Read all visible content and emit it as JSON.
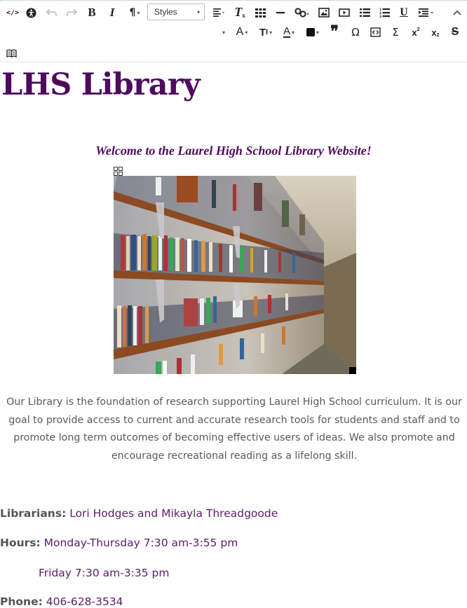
{
  "toolbar": {
    "row1": [
      {
        "name": "source-code-button",
        "glyph": "</>"
      },
      {
        "name": "accessibility-button",
        "glyph": "accessibility"
      },
      {
        "name": "undo-button",
        "glyph": "↶",
        "disabled": true
      },
      {
        "name": "redo-button",
        "glyph": "↷",
        "disabled": true
      },
      {
        "name": "bold-button",
        "glyph": "B"
      },
      {
        "name": "italic-button",
        "glyph": "I"
      },
      {
        "name": "paragraph-format-button",
        "glyph": "¶"
      }
    ],
    "styles_select": "Styles",
    "collapse_icon": "chevron-up-icon"
  },
  "page": {
    "title": "LHS Library",
    "welcome": "Welcome to the Laurel High School Library Website!",
    "intro": "Our Library is the foundation of research supporting Laurel High School curriculum.  It is our goal to provide access to current and accurate research tools for students and staff and to promote long term outcomes of becoming effective users of ideas.  We also promote and encourage recreational reading as a lifelong skill.",
    "librarians_label": "Librarians:",
    "librarians_value": "Lori Hodges and Mikayla Threadgoode",
    "hours_label": "Hours:",
    "hours_value": "Monday-Thursday 7:30 am-3:55 pm",
    "hours_friday": "Friday 7:30 am-3:35 pm",
    "phone_label": "Phone:",
    "phone_value": "406-628-3534"
  },
  "colors": {
    "heading": "#4e0b5e",
    "link_value": "#5d1b6e",
    "body_text": "#5a5a5a"
  }
}
